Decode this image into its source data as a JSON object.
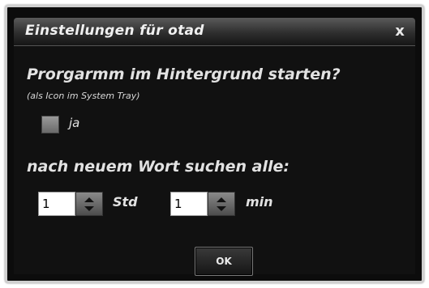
{
  "window": {
    "title": "Einstellungen für otad",
    "close_label": "x"
  },
  "background": {
    "question": "Prorgarmm im Hintergrund starten?",
    "subtitle": "(als Icon im System Tray)",
    "checkbox_label": "ja",
    "checked": false
  },
  "search": {
    "title": "nach neuem Wort suchen alle:",
    "hours_value": "1",
    "hours_unit": "Std",
    "minutes_value": "1",
    "minutes_unit": "min"
  },
  "buttons": {
    "ok_label": "OK"
  }
}
